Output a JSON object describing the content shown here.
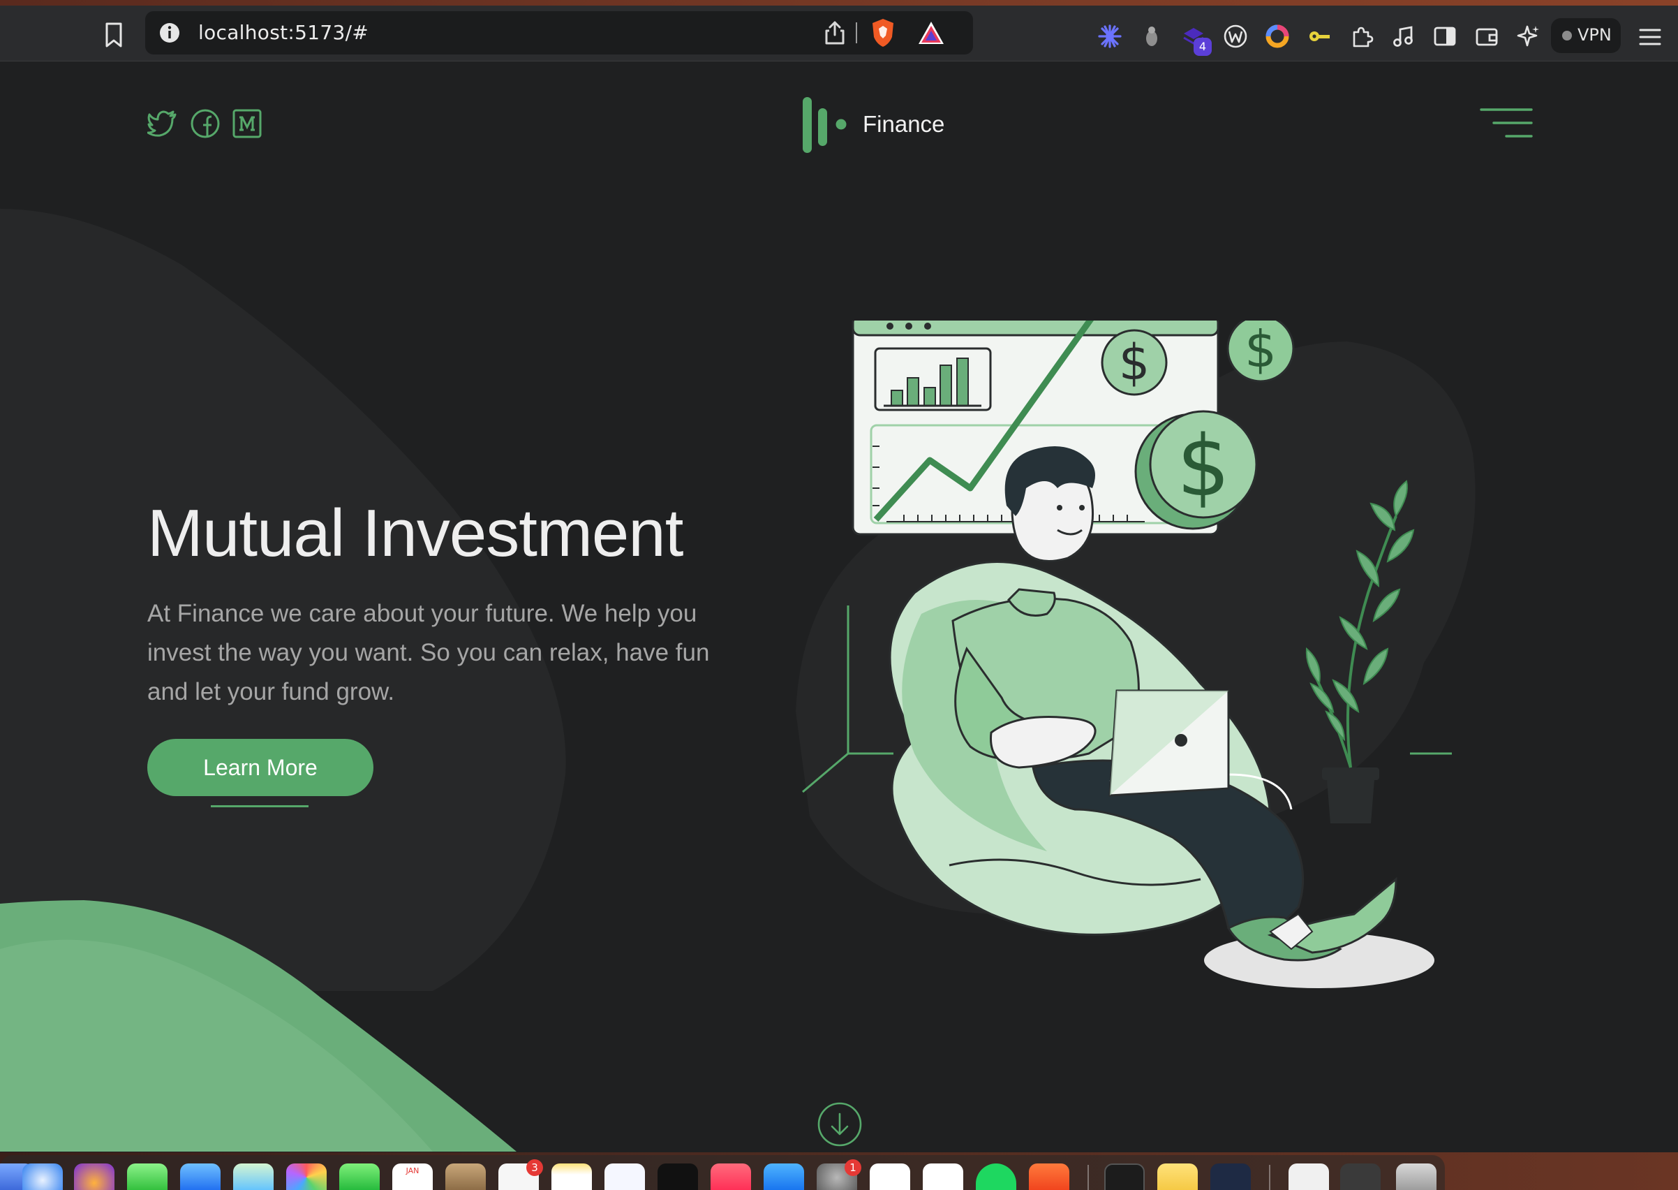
{
  "browser": {
    "url": "localhost:5173/#",
    "vpn_label": "VPN",
    "extension_badge": "4"
  },
  "header": {
    "brand": "Finance",
    "social_icons": [
      "twitter-icon",
      "facebook-icon",
      "medium-icon"
    ]
  },
  "hero": {
    "title": "Mutual Investment",
    "description": "At Finance we care about your future. We help you invest the way you want. So you can relax, have fun and let your fund grow.",
    "cta_label": "Learn More"
  },
  "dock": {
    "calendar_month": "JAN",
    "reminders_badge": "3",
    "settings_badge": "1"
  },
  "colors": {
    "accent": "#56a86a",
    "accent_light": "#8fcb99",
    "accent_pale": "#c7e5cc",
    "page_bg": "#1f2021",
    "text_primary": "#eeeeee",
    "text_secondary": "#a6a6a6"
  }
}
